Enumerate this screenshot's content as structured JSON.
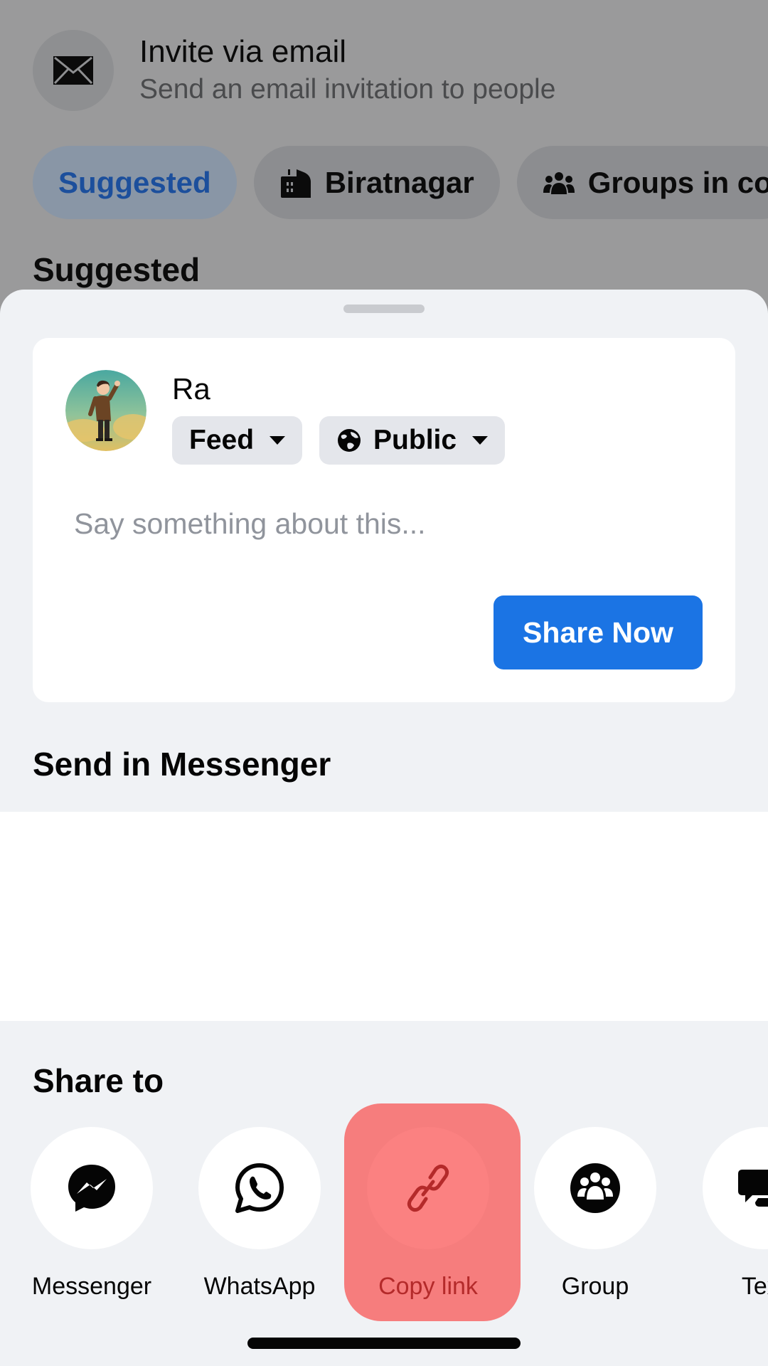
{
  "background": {
    "invite": {
      "title": "Invite via email",
      "subtitle": "Send an email invitation to people",
      "icon": "envelope-icon"
    },
    "chips": [
      {
        "label": "Suggested",
        "icon": null,
        "active": true
      },
      {
        "label": "Biratnagar",
        "icon": "city-buildings-icon",
        "active": false
      },
      {
        "label": "Groups in co",
        "icon": "group-people-icon",
        "active": false
      }
    ],
    "section_heading": "Suggested"
  },
  "share_sheet": {
    "compose": {
      "user_name": "Ra",
      "audience_target": "Feed",
      "privacy": "Public",
      "input_value": "",
      "input_placeholder": "Say something about this...",
      "share_button_label": "Share Now"
    },
    "send_in_messenger_heading": "Send in Messenger",
    "share_to_heading": "Share to",
    "targets": [
      {
        "label": "Messenger",
        "icon": "messenger-icon"
      },
      {
        "label": "WhatsApp",
        "icon": "whatsapp-icon"
      },
      {
        "label": "Copy link",
        "icon": "link-icon",
        "highlighted": true
      },
      {
        "label": "Group",
        "icon": "group-icon"
      },
      {
        "label": "Text",
        "icon": "text-message-icon"
      }
    ]
  },
  "colors": {
    "accent": "#1b74e4",
    "highlight": "#f67d7d",
    "highlight_text": "#b42a2a",
    "sheet_bg": "#f0f2f5"
  }
}
